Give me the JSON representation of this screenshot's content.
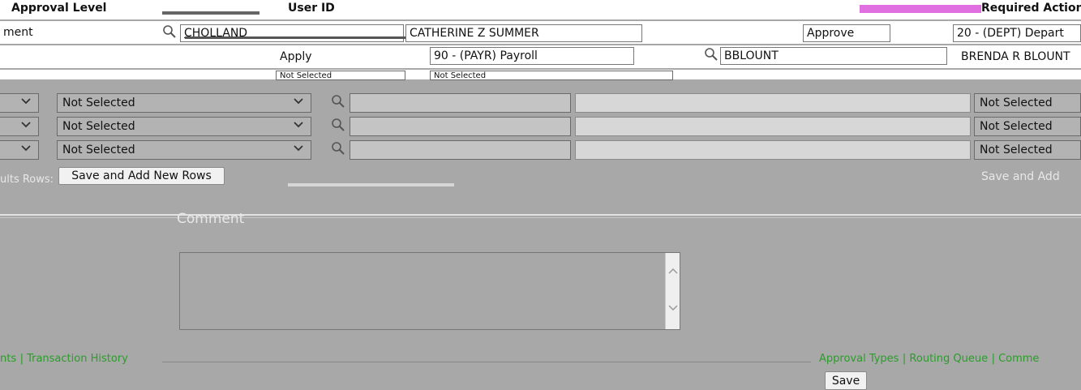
{
  "header": {
    "approval_level": "Approval Level",
    "user_id": "User ID",
    "required_action": "Required Action"
  },
  "row1": {
    "department_fragment": "ment",
    "user_id": "CHOLLAND",
    "user_name": "CATHERINE Z SUMMER",
    "action": "Approve",
    "department": "20 - (DEPT) Depart"
  },
  "row2": {
    "action": "Apply",
    "department": "90 - (PAYR) Payroll",
    "user_id": "BBLOUNT",
    "user_name": "BRENDA R BLOUNT"
  },
  "row3": {
    "select_a": "Not Selected",
    "select_b": "Not Selected"
  },
  "new_rows": [
    {
      "select": "Not Selected",
      "status": "Not Selected"
    },
    {
      "select": "Not Selected",
      "status": "Not Selected"
    },
    {
      "select": "Not Selected",
      "status": "Not Selected"
    }
  ],
  "actions": {
    "row_label_fragment": "ults Rows:",
    "save_and_add_rows": "Save and Add New Rows",
    "save_and_add_right": "Save and Add"
  },
  "comment": {
    "label": "Comment",
    "value": ""
  },
  "footer": {
    "left_links": [
      "nts",
      "Transaction History"
    ],
    "right_links": [
      "Approval Types",
      "Routing Queue",
      "Comme"
    ],
    "save_label": "Save"
  },
  "colors": {
    "overlay": "#a8a8a8",
    "link": "#2a9d2a",
    "accent_pink": "#e070e0"
  }
}
